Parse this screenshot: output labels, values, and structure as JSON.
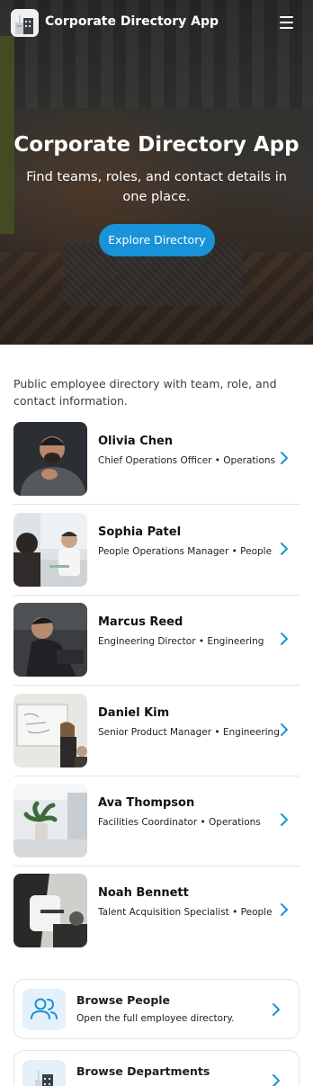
{
  "header": {
    "app_name": "Corporate Directory App",
    "logo_icon": "building-icon",
    "menu_icon": "hamburger-menu-icon"
  },
  "hero": {
    "title": "Corporate Directory App",
    "subtitle": "Find teams, roles, and contact details in one place.",
    "cta_label": "Explore Directory"
  },
  "intro": "Public employee directory with team, role, and contact information.",
  "people": [
    {
      "name": "Olivia Chen",
      "role": "Chief Operations Officer • Operations"
    },
    {
      "name": "Sophia Patel",
      "role": "People Operations Manager • People"
    },
    {
      "name": "Marcus Reed",
      "role": "Engineering Director • Engineering"
    },
    {
      "name": "Daniel Kim",
      "role": "Senior Product Manager • Engineering"
    },
    {
      "name": "Ava Thompson",
      "role": "Facilities Coordinator • Operations"
    },
    {
      "name": "Noah Bennett",
      "role": "Talent Acquisition Specialist • People"
    }
  ],
  "cards": [
    {
      "title": "Browse People",
      "description": "Open the full employee directory.",
      "icon": "people-icon"
    },
    {
      "title": "Browse Departments",
      "description": "",
      "icon": "building-icon"
    }
  ],
  "colors": {
    "accent": "#1893d8",
    "chevron": "#1893d8",
    "divider": "#e3e3e6"
  }
}
